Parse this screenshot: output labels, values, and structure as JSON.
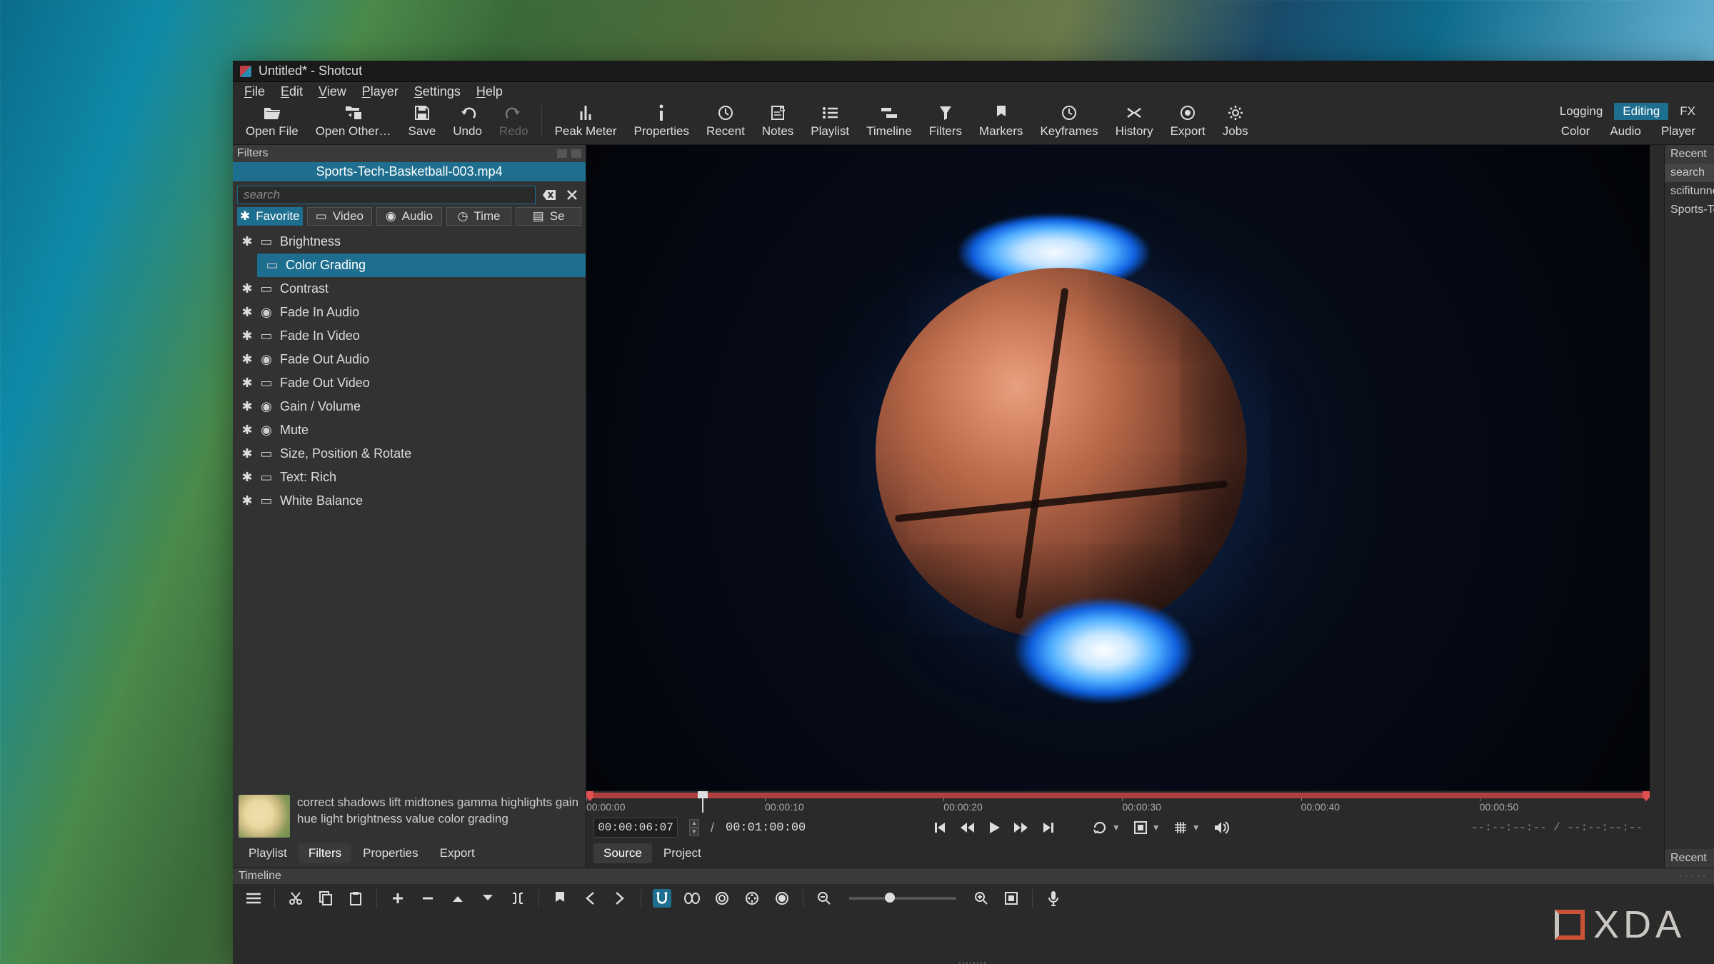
{
  "titlebar": {
    "title": "Untitled* - Shotcut"
  },
  "menu": {
    "items": [
      "File",
      "Edit",
      "View",
      "Player",
      "Settings",
      "Help"
    ]
  },
  "toolbar": {
    "items": [
      {
        "id": "open-file",
        "label": "Open File",
        "icon": "folder-open"
      },
      {
        "id": "open-other",
        "label": "Open Other…",
        "icon": "folder-arrow"
      },
      {
        "id": "save",
        "label": "Save",
        "icon": "save"
      },
      {
        "id": "undo",
        "label": "Undo",
        "icon": "undo"
      },
      {
        "id": "redo",
        "label": "Redo",
        "icon": "redo",
        "disabled": true
      }
    ],
    "items2": [
      {
        "id": "peak-meter",
        "label": "Peak Meter",
        "icon": "meter"
      },
      {
        "id": "properties",
        "label": "Properties",
        "icon": "info"
      },
      {
        "id": "recent",
        "label": "Recent",
        "icon": "clock"
      },
      {
        "id": "notes",
        "label": "Notes",
        "icon": "note"
      },
      {
        "id": "playlist",
        "label": "Playlist",
        "icon": "list"
      },
      {
        "id": "timeline",
        "label": "Timeline",
        "icon": "timeline"
      },
      {
        "id": "filters",
        "label": "Filters",
        "icon": "funnel"
      },
      {
        "id": "markers",
        "label": "Markers",
        "icon": "marker"
      },
      {
        "id": "keyframes",
        "label": "Keyframes",
        "icon": "keyframes"
      },
      {
        "id": "history",
        "label": "History",
        "icon": "history"
      },
      {
        "id": "export",
        "label": "Export",
        "icon": "record"
      },
      {
        "id": "jobs",
        "label": "Jobs",
        "icon": "gear"
      }
    ],
    "modes_row1": [
      {
        "id": "logging",
        "label": "Logging"
      },
      {
        "id": "editing",
        "label": "Editing",
        "active": true
      },
      {
        "id": "fx",
        "label": "FX"
      }
    ],
    "modes_row2": [
      {
        "id": "color",
        "label": "Color"
      },
      {
        "id": "audio",
        "label": "Audio"
      },
      {
        "id": "player",
        "label": "Player"
      }
    ]
  },
  "filters": {
    "panel_title": "Filters",
    "clip_name": "Sports-Tech-Basketball-003.mp4",
    "search_placeholder": "search",
    "tabs": [
      {
        "id": "favorite",
        "label": "Favorite",
        "icon": "✱",
        "active": true
      },
      {
        "id": "video",
        "label": "Video",
        "icon": "▭"
      },
      {
        "id": "audio",
        "label": "Audio",
        "icon": "◉"
      },
      {
        "id": "time",
        "label": "Time",
        "icon": "◷"
      },
      {
        "id": "set",
        "label": "Se",
        "icon": "▤"
      }
    ],
    "items": [
      {
        "name": "Brightness",
        "type": "video"
      },
      {
        "name": "Color Grading",
        "type": "video",
        "selected": true
      },
      {
        "name": "Contrast",
        "type": "video"
      },
      {
        "name": "Fade In Audio",
        "type": "audio"
      },
      {
        "name": "Fade In Video",
        "type": "video"
      },
      {
        "name": "Fade Out Audio",
        "type": "audio"
      },
      {
        "name": "Fade Out Video",
        "type": "video"
      },
      {
        "name": "Gain / Volume",
        "type": "audio"
      },
      {
        "name": "Mute",
        "type": "audio"
      },
      {
        "name": "Size, Position & Rotate",
        "type": "video"
      },
      {
        "name": "Text: Rich",
        "type": "video"
      },
      {
        "name": "White Balance",
        "type": "video"
      }
    ],
    "desc": "correct shadows lift midtones gamma highlights gain hue light brightness value color grading"
  },
  "bottom_tabs": [
    {
      "id": "playlist",
      "label": "Playlist"
    },
    {
      "id": "filters",
      "label": "Filters",
      "active": true
    },
    {
      "id": "properties",
      "label": "Properties"
    },
    {
      "id": "export",
      "label": "Export"
    }
  ],
  "ruler_ticks": [
    {
      "pos": 0,
      "label": "00:00:00"
    },
    {
      "pos": 16.8,
      "label": "00:00:10"
    },
    {
      "pos": 33.6,
      "label": "00:00:20"
    },
    {
      "pos": 50.4,
      "label": "00:00:30"
    },
    {
      "pos": 67.2,
      "label": "00:00:40"
    },
    {
      "pos": 84.0,
      "label": "00:00:50"
    }
  ],
  "playbar": {
    "current": "00:00:06:07",
    "sep": "/",
    "total": "00:01:00:00",
    "right": "--:--:--:--  /  --:--:--:--"
  },
  "source_tabs": [
    {
      "id": "source",
      "label": "Source",
      "active": true
    },
    {
      "id": "project",
      "label": "Project"
    }
  ],
  "recent": {
    "title": "Recent",
    "items": [
      "search",
      "scifitunnel",
      "Sports-Tec"
    ],
    "tab": "Recent"
  },
  "timeline": {
    "title": "Timeline"
  },
  "watermark": "XDA"
}
